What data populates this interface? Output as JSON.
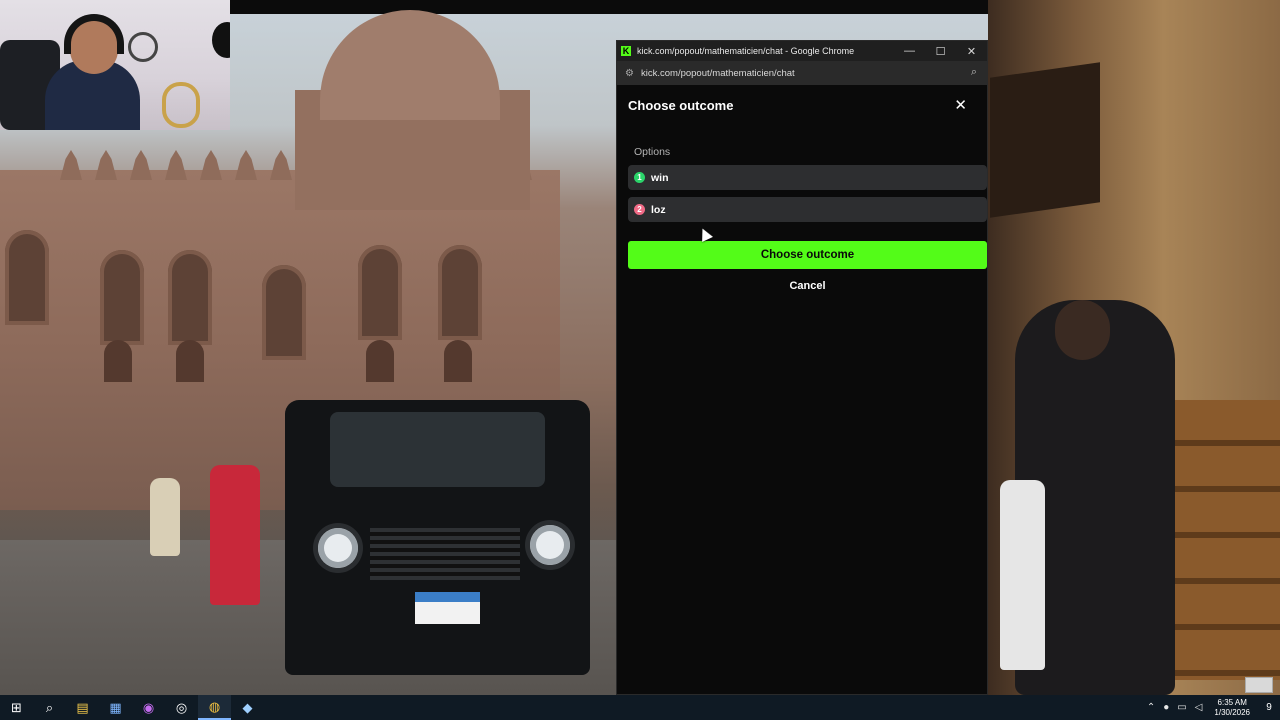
{
  "browser": {
    "window_title": "kick.com/popout/mathematicien/chat - Google Chrome",
    "logo_letter": "K",
    "url": "kick.com/popout/mathematicien/chat",
    "controls": {
      "minimize": "—",
      "maximize": "☐",
      "close": "✕"
    },
    "zoom_icon": "⌕",
    "site_info_icon": "⚙"
  },
  "dialog": {
    "title": "Choose outcome",
    "close_icon": "✕",
    "options_label": "Options",
    "options": [
      {
        "number": "1",
        "label": "win",
        "color": "#2bd46a"
      },
      {
        "number": "2",
        "label": "loz",
        "color": "#f06a86"
      }
    ],
    "primary_button": "Choose outcome",
    "cancel_button": "Cancel",
    "accent_color": "#53fc18"
  },
  "taskbar": {
    "apps": [
      {
        "name": "start",
        "glyph": "⊞"
      },
      {
        "name": "search",
        "glyph": "⌕"
      },
      {
        "name": "file-explorer",
        "glyph": "▤"
      },
      {
        "name": "store",
        "glyph": "▦"
      },
      {
        "name": "messenger",
        "glyph": "◉"
      },
      {
        "name": "obs",
        "glyph": "◎"
      },
      {
        "name": "chrome",
        "glyph": "◍"
      },
      {
        "name": "steam",
        "glyph": "◆"
      }
    ],
    "time": "6:35 AM",
    "date": "1/30/2026",
    "notification_count": "9"
  }
}
